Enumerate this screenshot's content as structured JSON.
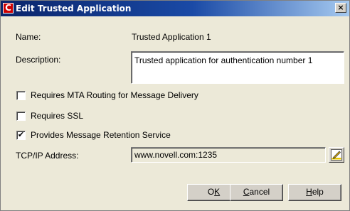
{
  "window": {
    "title": "Edit Trusted Application",
    "icon": "novell-red-n-icon",
    "close_glyph": "×"
  },
  "fields": {
    "name_label": "Name:",
    "name_value": "Trusted Application 1",
    "description_label": "Description:",
    "description_value": "Trusted application for authentication number 1",
    "tcpip_label": "TCP/IP Address:",
    "tcpip_value": "www.novell.com:1235"
  },
  "options": [
    {
      "label": "Requires MTA Routing for Message Delivery",
      "checked": false
    },
    {
      "label": "Requires SSL",
      "checked": false
    },
    {
      "label": "Provides Message Retention Service",
      "checked": true
    }
  ],
  "buttons": {
    "ok": {
      "pre": "O",
      "mnemonic": "K",
      "post": ""
    },
    "cancel": {
      "pre": "",
      "mnemonic": "C",
      "post": "ancel"
    },
    "help": {
      "pre": "",
      "mnemonic": "H",
      "post": "elp"
    }
  },
  "colors": {
    "title_gradient_start": "#0a246a",
    "dialog_bg": "#ece9d8",
    "icon_red": "#cc0000"
  }
}
